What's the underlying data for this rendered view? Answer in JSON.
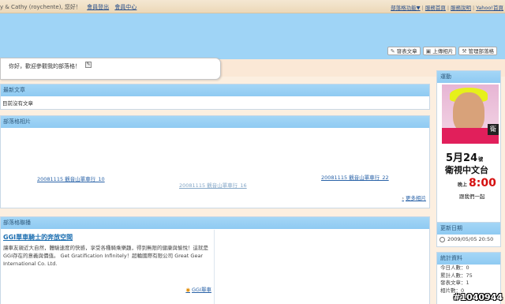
{
  "topbar": {
    "greeting": "y & Cathy (roychente), 您好！",
    "logout": "會員登出",
    "member_center": "會員中心",
    "right_links": [
      "部落格功能▼",
      "服務首頁",
      "服務說明",
      "Yahoo!首頁"
    ]
  },
  "toolbar": {
    "post": "發表文章",
    "upload": "上傳相片",
    "manage": "管理部落格"
  },
  "welcome": {
    "text": "你好，歡迎參觀我的部落格！"
  },
  "latest_articles": {
    "title": "最新文章",
    "empty_text": "目前沒有文章"
  },
  "photos": {
    "title": "部落格相片",
    "captions": [
      "20081115 觀音山單車行_10",
      "20081115 觀音山單車行_16",
      "20081115 觀音山單車行_22"
    ],
    "more": "更多相片"
  },
  "links": {
    "title": "部落格聯播",
    "blog_title": "GGI單車騎士的奔放空間",
    "blog_desc": "讓車友親近大自然，體驗速度的快感，享受各種騎乘樂趣，得到無限的健康與愉悅！這就是GGI存在的意義與價值。 Get Gratification Infinitely！超輪國際有限公司 Great Gear International Co. Ltd.",
    "blog_link": "GGI單車"
  },
  "sidebar": {
    "ad_title": "運動",
    "ad": {
      "date": "5月24",
      "date_unit": "號",
      "channel": "衛視中文台",
      "time_prefix": "晚上",
      "time": "8:00",
      "tagline": "跟我們一起"
    },
    "updated_title": "更新日期",
    "updated_value": "2009/05/05 20:50",
    "stats_title": "統計資料",
    "stats": [
      "今日人數：0",
      "累計人數：75",
      "發表文章：1",
      "相片數：0"
    ]
  },
  "watermark": "#1040944",
  "colors": {
    "header": "#9fd4f6",
    "panel_header": "#a4d6f6",
    "link": "#2a63a8",
    "background": "#fcefe0"
  }
}
